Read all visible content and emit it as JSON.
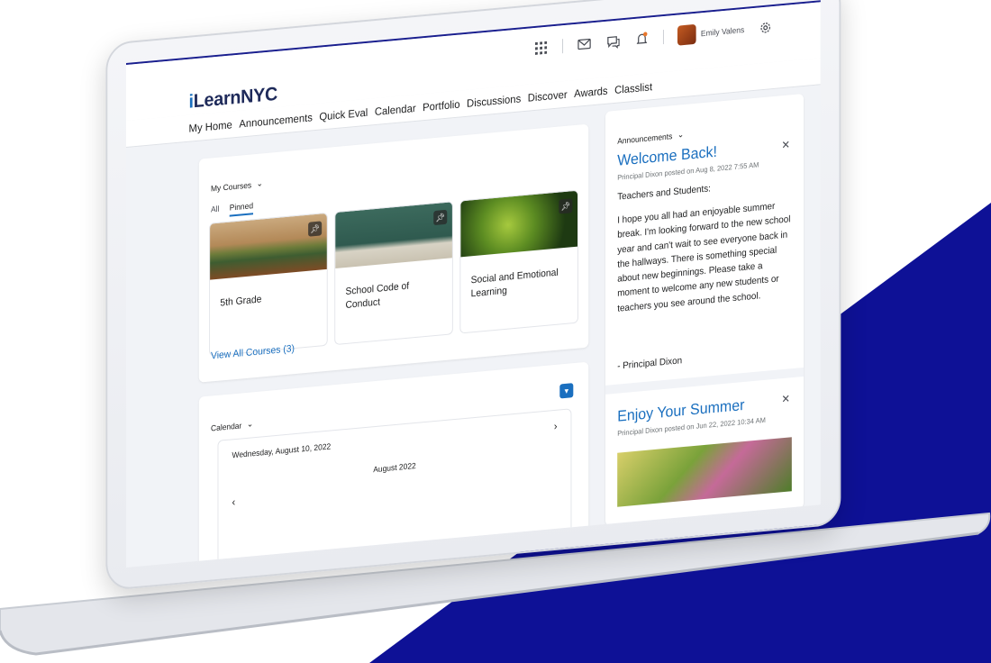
{
  "colors": {
    "brand_blue": "#1a6fbf",
    "navy": "#1e2a5a",
    "background_shape": "#0e1196",
    "page_bg": "#f1f3f7"
  },
  "header": {
    "logo_prefix": "i",
    "logo_rest": "LearnNYC",
    "icons": [
      "grid-icon",
      "mail-icon",
      "chat-icon",
      "bell-icon",
      "gear-icon"
    ],
    "user_name": "Emily Valens"
  },
  "nav": {
    "items": [
      "My Home",
      "Announcements",
      "Quick Eval",
      "Calendar",
      "Portfolio",
      "Discussions",
      "Discover",
      "Awards",
      "Classlist"
    ]
  },
  "courses": {
    "title": "My Courses",
    "tabs": [
      "All",
      "Pinned"
    ],
    "active_tab": "Pinned",
    "tiles": [
      {
        "name": "5th Grade"
      },
      {
        "name": "School Code of Conduct"
      },
      {
        "name": "Social and Emotional Learning"
      }
    ],
    "view_all": "View All Courses (3)"
  },
  "calendar": {
    "title": "Calendar",
    "date": "Wednesday, August 10, 2022",
    "month": "August 2022",
    "prev": "‹",
    "next": "›"
  },
  "announcements": {
    "title": "Announcements",
    "items": [
      {
        "heading": "Welcome Back!",
        "meta": "Principal Dixon posted on Aug 8, 2022 7:55 AM",
        "greeting": "Teachers and Students:",
        "body": "I hope you all had an enjoyable summer break. I'm looking forward to the new school year and can't wait to see everyone back in the hallways. There is something special about new beginnings. Please take a moment to welcome any new students or teachers you see around the school.",
        "signature": "- Principal Dixon"
      },
      {
        "heading": "Enjoy Your Summer",
        "meta": "Principal Dixon posted on Jun 22, 2022 10:34 AM"
      }
    ]
  }
}
